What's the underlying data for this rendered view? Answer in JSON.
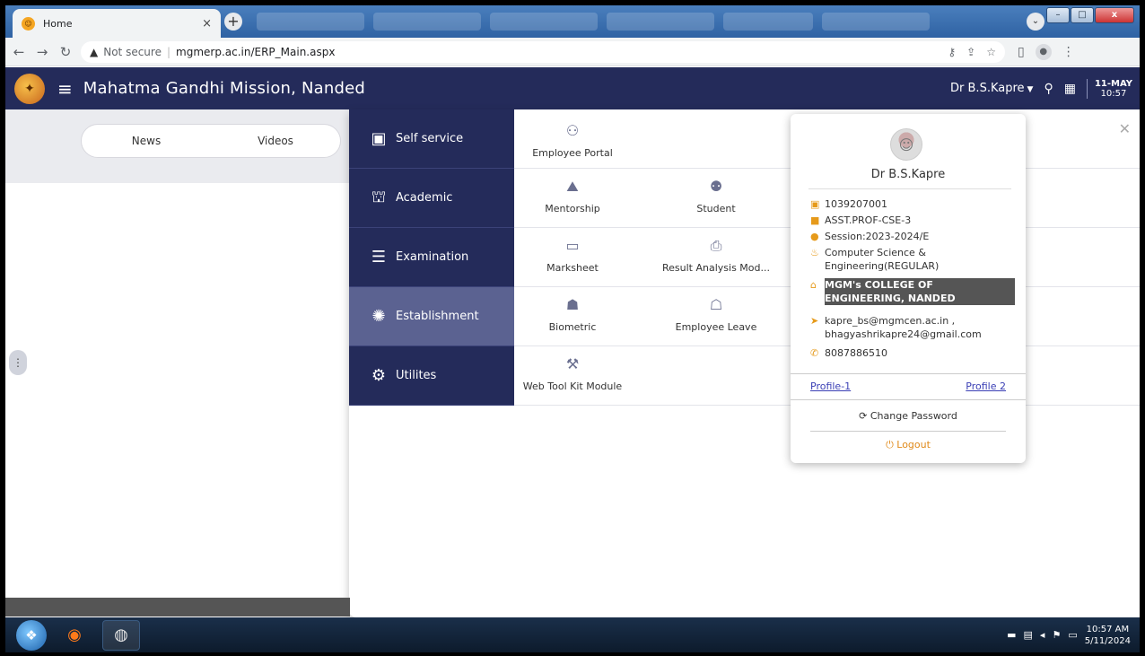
{
  "browser": {
    "tab_title": "Home",
    "tab_close": "×",
    "new_tab": "+",
    "not_secure": "Not secure",
    "url": "mgmerp.ac.in/ERP_Main.aspx"
  },
  "header": {
    "title": "Mahatma Gandhi Mission, Nanded",
    "user": "Dr B.S.Kapre",
    "date": "11-MAY",
    "time": "10:57"
  },
  "tabs": {
    "news": "News",
    "videos": "Videos"
  },
  "menu": {
    "categories": [
      {
        "label": "Self service",
        "icon": "kiosk-icon"
      },
      {
        "label": "Academic",
        "icon": "classroom-icon"
      },
      {
        "label": "Examination",
        "icon": "exam-icon"
      },
      {
        "label": "Establishment",
        "icon": "establishment-icon"
      },
      {
        "label": "Utilites",
        "icon": "gears-icon"
      }
    ],
    "items": {
      "employee_portal": "Employee Portal",
      "mentorship": "Mentorship",
      "student": "Student",
      "marksheet": "Marksheet",
      "result_analysis": "Result Analysis Mod...",
      "biometric": "Biometric",
      "employee_leave": "Employee Leave",
      "web_tool_kit": "Web Tool Kit Module"
    }
  },
  "profile": {
    "name": "Dr B.S.Kapre",
    "id": "1039207001",
    "designation": "ASST.PROF-CSE-3",
    "session": "Session:2023-2024/E",
    "department": "Computer Science & Engineering(REGULAR)",
    "college": "MGM's COLLEGE OF ENGINEERING, NANDED",
    "emails": "kapre_bs@mgmcen.ac.in , bhagyashrikapre24@gmail.com",
    "phone": "8087886510",
    "profile1": "Profile-1",
    "profile2": "Profile 2",
    "change_password": "Change Password",
    "logout": "Logout"
  },
  "taskbar": {
    "time": "10:57 AM",
    "date": "5/11/2024"
  },
  "colors": {
    "header": "#242b5a",
    "active_category": "#5b6291",
    "accent": "#e69a1a",
    "link": "#3a3fb5"
  }
}
